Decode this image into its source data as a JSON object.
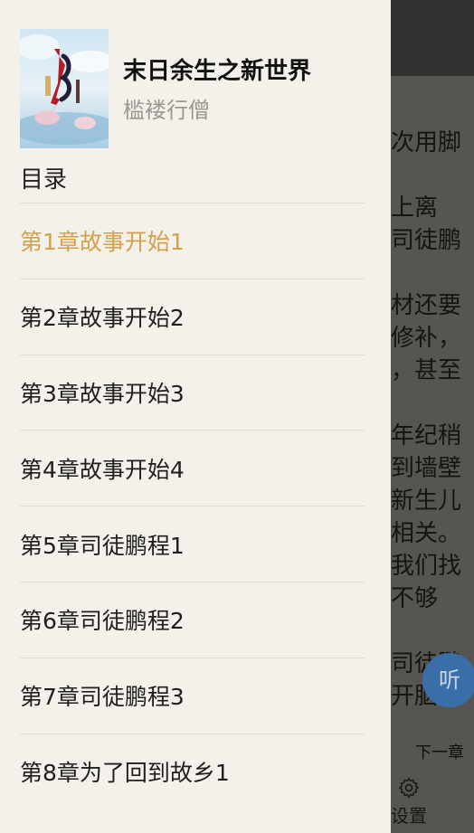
{
  "book": {
    "title": "末日余生之新世界",
    "author": "槛褛行僧"
  },
  "toc_label": "目录",
  "chapters": [
    {
      "label": "第1章故事开始1",
      "active": true
    },
    {
      "label": "第2章故事开始2",
      "active": false
    },
    {
      "label": "第3章故事开始3",
      "active": false
    },
    {
      "label": "第4章故事开始4",
      "active": false
    },
    {
      "label": "第5章司徒鹏程1",
      "active": false
    },
    {
      "label": "第6章司徒鹏程2",
      "active": false
    },
    {
      "label": "第7章司徒鹏程3",
      "active": false
    },
    {
      "label": "第8章为了回到故乡1",
      "active": false
    }
  ],
  "reader": {
    "lines": [
      "次用脚",
      "",
      "上离",
      "司徒鹏",
      "",
      "材还要",
      "修补，",
      "，甚至",
      "",
      "年纪稍",
      "到墙壁",
      "新生儿",
      "相关。",
      "我们找",
      "不够",
      "",
      "司徒鹏",
      "开脑"
    ],
    "listen_label": "听",
    "next_chapter_label": "下一章",
    "settings_label": "设置"
  },
  "colors": {
    "active_chapter": "#d4a04b",
    "drawer_bg": "#f4f0ea",
    "listen_button": "#3a6ea9"
  }
}
